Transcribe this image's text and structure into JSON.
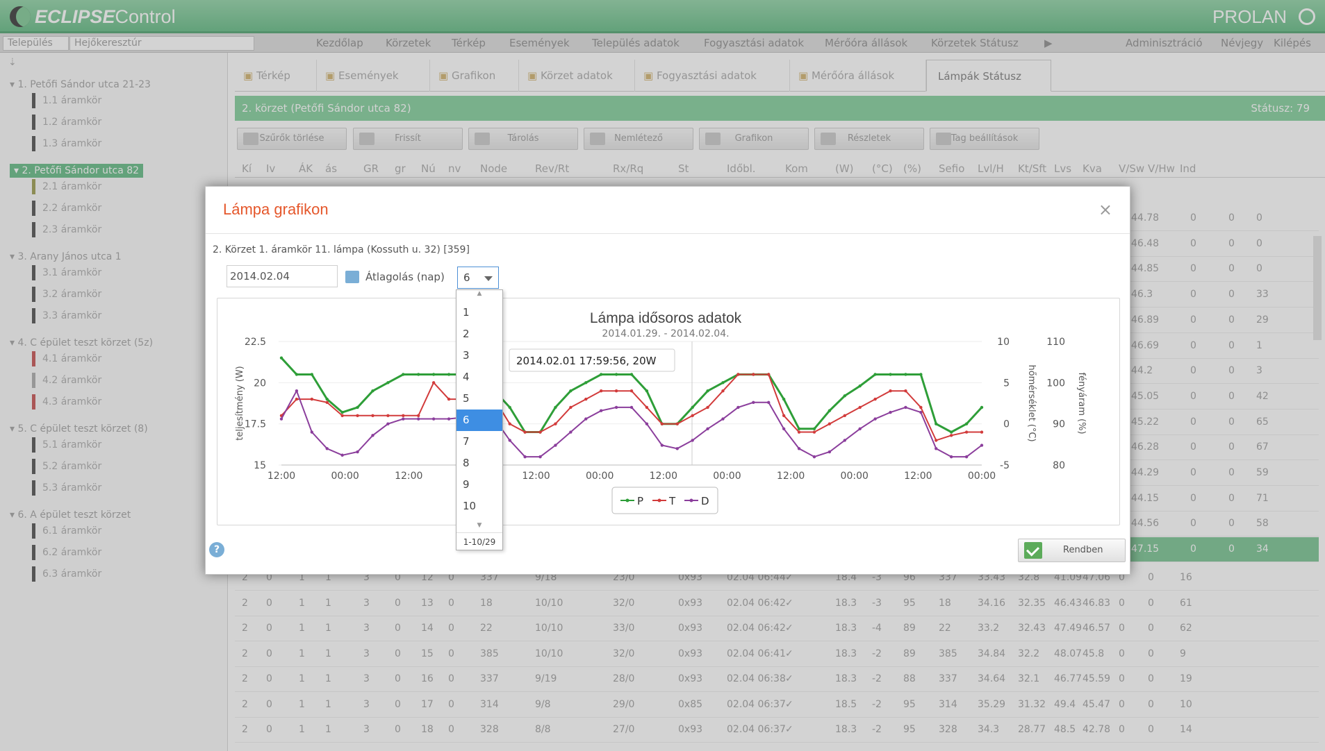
{
  "app": {
    "title_brand": "ECLIPSE",
    "title_rest": " Control",
    "vendor": "PROLAN"
  },
  "menubar": {
    "city_label": "Település",
    "city_value": "Hejőkeresztúr",
    "items": [
      "Kezdőlap",
      "Körzetek",
      "Térkép",
      "Események",
      "Település adatok",
      "Fogyasztási adatok",
      "Mérőóra állások",
      "Körzetek Státusz"
    ],
    "more": "▶",
    "right_items": [
      "Adminisztráció",
      "Névjegy",
      "Kilépés"
    ]
  },
  "sidebar": {
    "groups": [
      {
        "label": "1. Petőfi Sándor utca 21-23",
        "leaves": [
          "1.1 áramkör",
          "1.2 áramkör",
          "1.3 áramkör"
        ]
      },
      {
        "label": "2. Petőfi Sándor utca 82",
        "leaves": [
          "2.1 áramkör",
          "2.2 áramkör",
          "2.3 áramkör"
        ]
      },
      {
        "label": "3. Arany János utca 1",
        "leaves": [
          "3.1 áramkör",
          "3.2 áramkör",
          "3.3 áramkör"
        ]
      },
      {
        "label": "4. C épület teszt körzet (5z)",
        "leaves": [
          "4.1 áramkör",
          "4.2 áramkör",
          "4.3 áramkör"
        ]
      },
      {
        "label": "5. C épület teszt körzet (8)",
        "leaves": [
          "5.1 áramkör",
          "5.2 áramkör",
          "5.3 áramkör"
        ]
      },
      {
        "label": "6. A épület teszt körzet",
        "leaves": [
          "6.1 áramkör",
          "6.2 áramkör",
          "6.3 áramkör"
        ]
      }
    ]
  },
  "tabs": [
    "Térkép",
    "Események",
    "Grafikon",
    "Körzet adatok",
    "Fogyasztási adatok",
    "Mérőóra állások",
    "Lámpák Státusz"
  ],
  "greenbar": {
    "title": "2. körzet (Petőfi Sándor utca 82)",
    "status": "Státusz: 79"
  },
  "toolbar": [
    "Szűrők törlése",
    "Frissít",
    "Tárolás",
    "Nemlétező",
    "Grafikon",
    "Részletek",
    "Tag beállítások"
  ],
  "columns": [
    "Kí",
    "Iv",
    "ÁK",
    "ás",
    "GR",
    "gr",
    "Nú",
    "nv",
    "Node",
    "Rev/Rt",
    "Rx/Rq",
    "St",
    "Időbl.",
    "Kom",
    "(W)",
    "(°C)",
    "(%)",
    "Sefio",
    "Lvl/H",
    "Kt/Sft",
    "Lvs",
    "Kva",
    "V/Sw",
    "V/Hw",
    "Ind"
  ],
  "right_values": [
    [
      "44.78",
      "0",
      "0",
      "0"
    ],
    [
      "46.48",
      "0",
      "0",
      "0"
    ],
    [
      "44.85",
      "0",
      "0",
      "0"
    ],
    [
      "46.3",
      "0",
      "0",
      "33"
    ],
    [
      "46.89",
      "0",
      "0",
      "29"
    ],
    [
      "46.69",
      "0",
      "0",
      "1"
    ],
    [
      "44.2",
      "0",
      "0",
      "3"
    ],
    [
      "45.05",
      "0",
      "0",
      "42"
    ],
    [
      "45.22",
      "0",
      "0",
      "65"
    ],
    [
      "46.28",
      "0",
      "0",
      "67"
    ],
    [
      "44.29",
      "0",
      "0",
      "59"
    ],
    [
      "44.15",
      "0",
      "0",
      "71"
    ],
    [
      "44.56",
      "0",
      "0",
      "58"
    ],
    [
      "47.15",
      "0",
      "0",
      "34"
    ]
  ],
  "rows": [
    [
      "2",
      "0",
      "1",
      "1",
      "3",
      "0",
      "12",
      "0",
      "337",
      "9/18",
      "23/0",
      "0x93",
      "02.04 06:44",
      "✓",
      "18.4",
      "-3",
      "96",
      "337",
      "33.43",
      "32.8",
      "41.09",
      "47.06",
      "0",
      "0",
      "16"
    ],
    [
      "2",
      "0",
      "1",
      "1",
      "3",
      "0",
      "13",
      "0",
      "18",
      "10/10",
      "32/0",
      "0x93",
      "02.04 06:42",
      "✓",
      "18.3",
      "-3",
      "95",
      "18",
      "34.16",
      "32.35",
      "46.43",
      "46.83",
      "0",
      "0",
      "61"
    ],
    [
      "2",
      "0",
      "1",
      "1",
      "3",
      "0",
      "14",
      "0",
      "22",
      "10/10",
      "33/0",
      "0x93",
      "02.04 06:42",
      "✓",
      "18.3",
      "-4",
      "89",
      "22",
      "33.2",
      "32.43",
      "47.49",
      "46.57",
      "0",
      "0",
      "62"
    ],
    [
      "2",
      "0",
      "1",
      "1",
      "3",
      "0",
      "15",
      "0",
      "385",
      "10/10",
      "32/0",
      "0x93",
      "02.04 06:41",
      "✓",
      "18.3",
      "-2",
      "89",
      "385",
      "34.84",
      "32.2",
      "48.07",
      "45.8",
      "0",
      "0",
      "9"
    ],
    [
      "2",
      "0",
      "1",
      "1",
      "3",
      "0",
      "16",
      "0",
      "337",
      "9/19",
      "28/0",
      "0x93",
      "02.04 06:38",
      "✓",
      "18.3",
      "-2",
      "88",
      "337",
      "34.64",
      "32.1",
      "46.77",
      "45.59",
      "0",
      "0",
      "19"
    ],
    [
      "2",
      "0",
      "1",
      "1",
      "3",
      "0",
      "17",
      "0",
      "314",
      "9/8",
      "29/0",
      "0x85",
      "02.04 06:37",
      "✓",
      "18.5",
      "-2",
      "95",
      "314",
      "35.29",
      "31.32",
      "49.4",
      "45.47",
      "0",
      "0",
      "10"
    ],
    [
      "2",
      "0",
      "1",
      "1",
      "3",
      "0",
      "18",
      "0",
      "328",
      "8/8",
      "27/0",
      "0x93",
      "02.04 06:37",
      "✓",
      "18.3",
      "-2",
      "95",
      "328",
      "34.3",
      "28.77",
      "48.5",
      "42.78",
      "0",
      "0",
      "14"
    ]
  ],
  "modal": {
    "title": "Lámpa grafikon",
    "close": "×",
    "subtitle": "2. Körzet 1. áramkör 11. lámpa (Kossuth u. 32) [359]",
    "date": "2014.02.04",
    "avg_label": "Átlagolás (nap)",
    "avg_value": "6",
    "ok_label": "Rendben",
    "help": "?"
  },
  "dropdown": {
    "options": [
      "1",
      "2",
      "3",
      "4",
      "5",
      "6",
      "7",
      "8",
      "9",
      "10"
    ],
    "selected": "6",
    "pager": "1-10/29"
  },
  "chart_data": {
    "type": "line",
    "title": "Lámpa idősoros adatok",
    "subtitle": "2014.01.29. - 2014.02.04.",
    "y_left": {
      "label": "teljesítmény (W)",
      "range": [
        15,
        22.5
      ],
      "ticks": [
        "15",
        "17.5",
        "20",
        "22.5"
      ]
    },
    "y_right1": {
      "label": "hőmérséklet (°C)",
      "range": [
        -5,
        10
      ],
      "ticks": [
        "-5",
        "0",
        "5",
        "10"
      ]
    },
    "y_right2": {
      "label": "fényáram (%)",
      "range": [
        80,
        110
      ],
      "ticks": [
        "80",
        "90",
        "100",
        "110"
      ]
    },
    "x_ticks": [
      "12:00",
      "00:00",
      "12:00",
      "00:00",
      "12:00",
      "00:00",
      "12:00",
      "00:00",
      "12:00",
      "00:00",
      "12:00",
      "00:00"
    ],
    "legend": [
      "P",
      "T",
      "D"
    ],
    "tooltip": "2014.02.01 17:59:56, 20W",
    "series_colors": {
      "P": "#2e9e38",
      "T": "#d23b3b",
      "D": "#8b3e9c"
    },
    "series": [
      {
        "name": "P",
        "values": [
          21.5,
          20.5,
          20.5,
          19.0,
          18.2,
          18.5,
          19.5,
          20.0,
          20.5,
          20.5,
          20.5,
          20.5,
          20.5,
          20.0,
          19.5,
          18.5,
          17.0,
          17.0,
          18.5,
          19.5,
          20.0,
          20.5,
          20.5,
          20.5,
          19.5,
          17.5,
          17.5,
          18.5,
          19.5,
          20.0,
          20.5,
          20.5,
          20.5,
          19.0,
          17.2,
          17.2,
          18.3,
          19.2,
          19.8,
          20.5,
          20.5,
          20.5,
          20.5,
          17.5,
          17.0,
          17.5,
          18.5
        ]
      },
      {
        "name": "T",
        "values": [
          18.0,
          19.0,
          19.0,
          18.8,
          18.0,
          18.0,
          18.0,
          18.0,
          18.0,
          18.0,
          20.0,
          19.0,
          19.0,
          19.0,
          19.0,
          17.5,
          17.0,
          17.0,
          17.5,
          18.5,
          19.0,
          19.5,
          19.5,
          19.5,
          18.5,
          17.5,
          17.5,
          18.0,
          18.5,
          19.5,
          20.5,
          20.5,
          20.5,
          18.0,
          17.0,
          17.0,
          17.5,
          18.0,
          18.5,
          19.0,
          19.5,
          19.5,
          18.5,
          16.5,
          16.8,
          17.0,
          17.0
        ]
      },
      {
        "name": "D",
        "values": [
          17.8,
          19.5,
          17.0,
          16.0,
          15.6,
          15.8,
          16.8,
          17.5,
          17.8,
          17.8,
          17.8,
          17.8,
          17.9,
          18.0,
          17.8,
          16.5,
          15.5,
          15.5,
          16.2,
          17.0,
          17.8,
          18.3,
          18.5,
          18.5,
          17.5,
          16.2,
          16.0,
          16.5,
          17.2,
          17.8,
          18.5,
          18.8,
          18.8,
          17.2,
          16.0,
          15.5,
          15.8,
          16.5,
          17.2,
          17.8,
          18.2,
          18.5,
          18.2,
          16.0,
          15.5,
          15.5,
          16.2
        ]
      }
    ]
  }
}
